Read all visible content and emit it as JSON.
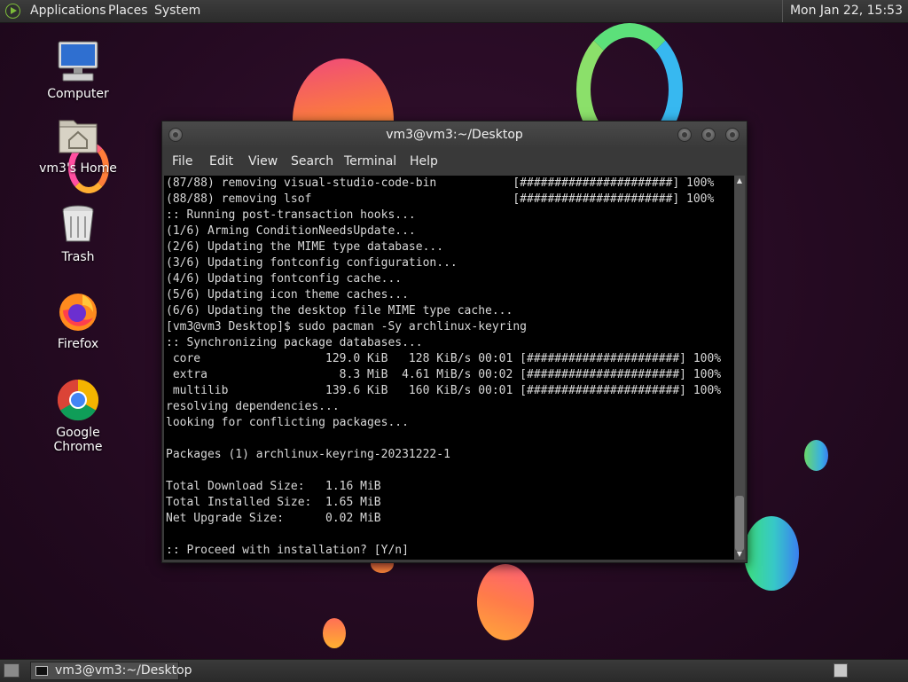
{
  "top_panel": {
    "logo_icon": "applications-logo-icon",
    "menus": [
      "Applications",
      "Places",
      "System"
    ],
    "clock": "Mon Jan 22, 15:53"
  },
  "desktop": {
    "icons": [
      {
        "label": "Computer",
        "icon": "computer-icon"
      },
      {
        "label": "vm3's Home",
        "icon": "home-folder-icon"
      },
      {
        "label": "Trash",
        "icon": "trash-icon"
      },
      {
        "label": "Firefox",
        "icon": "firefox-icon"
      },
      {
        "label": "Google Chrome",
        "icon": "chrome-icon"
      }
    ]
  },
  "terminal": {
    "title": "vm3@vm3:~/Desktop",
    "menu": [
      "File",
      "Edit",
      "View",
      "Search",
      "Terminal",
      "Help"
    ],
    "lines": [
      "(87/88) removing visual-studio-code-bin           [######################] 100%",
      "(88/88) removing lsof                             [######################] 100%",
      ":: Running post-transaction hooks...",
      "(1/6) Arming ConditionNeedsUpdate...",
      "(2/6) Updating the MIME type database...",
      "(3/6) Updating fontconfig configuration...",
      "(4/6) Updating fontconfig cache...",
      "(5/6) Updating icon theme caches...",
      "(6/6) Updating the desktop file MIME type cache...",
      "[vm3@vm3 Desktop]$ sudo pacman -Sy archlinux-keyring",
      ":: Synchronizing package databases...",
      " core                  129.0 KiB   128 KiB/s 00:01 [######################] 100%",
      " extra                   8.3 MiB  4.61 MiB/s 00:02 [######################] 100%",
      " multilib              139.6 KiB   160 KiB/s 00:01 [######################] 100%",
      "resolving dependencies...",
      "looking for conflicting packages...",
      "",
      "Packages (1) archlinux-keyring-20231222-1",
      "",
      "Total Download Size:   1.16 MiB",
      "Total Installed Size:  1.65 MiB",
      "Net Upgrade Size:      0.02 MiB",
      "",
      ":: Proceed with installation? [Y/n] "
    ]
  },
  "bottom_panel": {
    "task_label": "vm3@vm3:~/Desktop"
  }
}
